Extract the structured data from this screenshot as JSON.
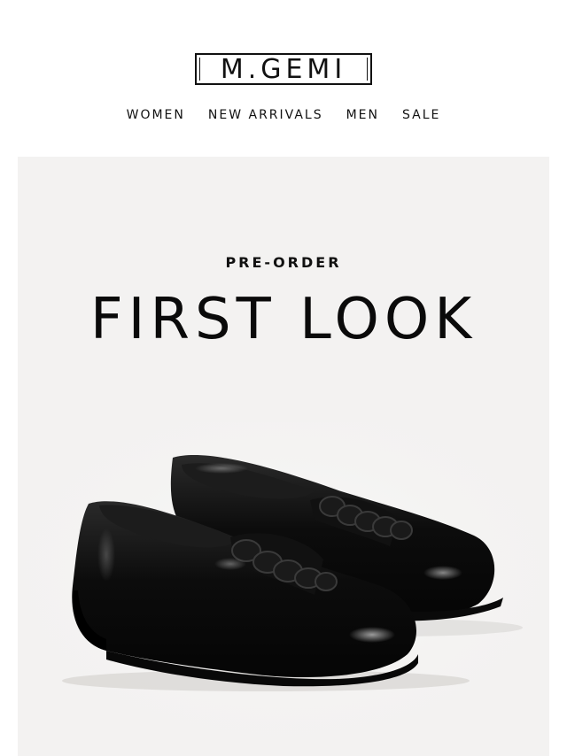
{
  "header": {
    "logo_text": "M.GEMI",
    "nav": [
      {
        "label": "WOMEN"
      },
      {
        "label": "NEW ARRIVALS"
      },
      {
        "label": "MEN"
      },
      {
        "label": "SALE"
      }
    ]
  },
  "hero": {
    "eyebrow": "PRE-ORDER",
    "title": "FIRST LOOK",
    "image": "black-patent-chain-loafers",
    "background": "#f3f2f1"
  }
}
